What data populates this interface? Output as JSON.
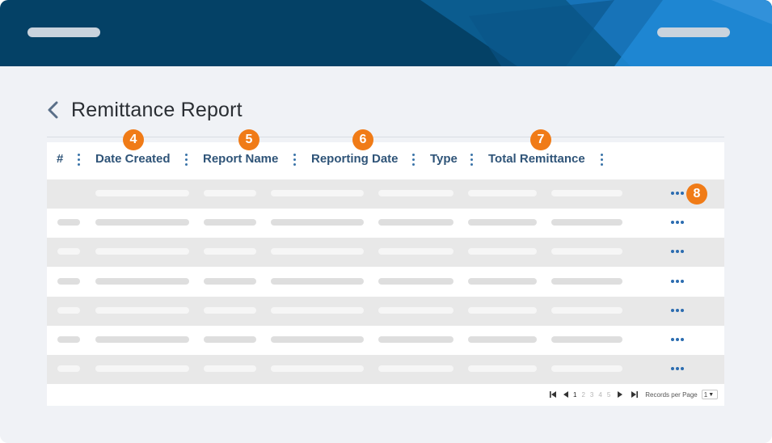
{
  "page": {
    "title": "Remittance Report"
  },
  "table": {
    "columns": [
      {
        "label": "#"
      },
      {
        "label": "Date Created"
      },
      {
        "label": "Report Name"
      },
      {
        "label": "Reporting Date"
      },
      {
        "label": "Type"
      },
      {
        "label": "Total Remittance"
      }
    ],
    "row_count": 7
  },
  "callouts": [
    "4",
    "5",
    "6",
    "7",
    "8"
  ],
  "pagination": {
    "pages": [
      "1",
      "2",
      "3",
      "4",
      "5"
    ],
    "current": "1",
    "records_label": "Records per Page",
    "per_page": "1"
  },
  "colors": {
    "banner": "#044166",
    "accent": "#1e8ad6",
    "header_text": "#2f5478",
    "callout": "#f07b17"
  }
}
